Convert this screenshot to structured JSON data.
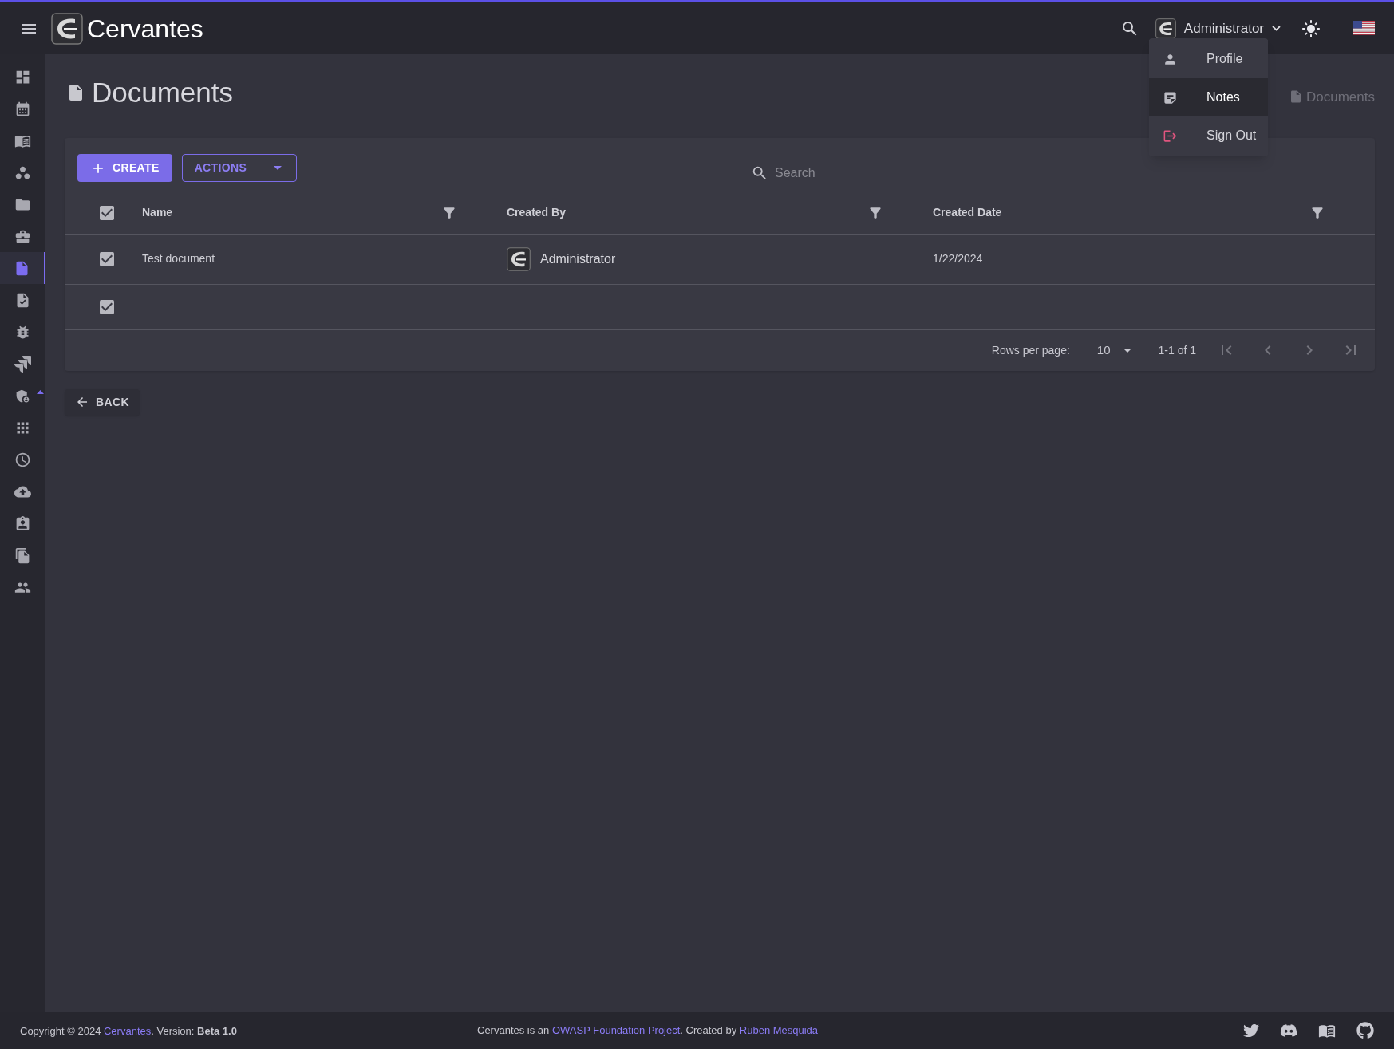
{
  "header": {
    "app_name": "Cervantes",
    "user_name": "Administrator"
  },
  "user_menu": [
    {
      "kind": "profile",
      "label": "Profile",
      "selected": false
    },
    {
      "kind": "notes",
      "label": "Notes",
      "selected": true
    },
    {
      "kind": "signout",
      "label": "Sign Out",
      "selected": false
    }
  ],
  "sidebar": {
    "items": [
      {
        "kind": "dashboard",
        "selected": false
      },
      {
        "kind": "calendar",
        "selected": false
      },
      {
        "kind": "book",
        "selected": false
      },
      {
        "kind": "circles",
        "selected": false
      },
      {
        "kind": "folder",
        "selected": false
      },
      {
        "kind": "briefcase",
        "selected": false
      },
      {
        "kind": "document",
        "selected": true
      },
      {
        "kind": "task",
        "selected": false
      },
      {
        "kind": "bug",
        "selected": false
      },
      {
        "kind": "jira",
        "selected": false
      },
      {
        "kind": "shield",
        "selected": false
      },
      {
        "kind": "grid",
        "selected": false
      },
      {
        "kind": "clock",
        "selected": false
      },
      {
        "kind": "upload",
        "selected": false
      },
      {
        "kind": "badge",
        "selected": false
      },
      {
        "kind": "copy",
        "selected": false
      },
      {
        "kind": "people",
        "selected": false
      }
    ]
  },
  "page": {
    "title": "Documents",
    "breadcrumb": "Documents"
  },
  "toolbar": {
    "create": "CREATE",
    "actions": "ACTIONS",
    "search_placeholder": "Search"
  },
  "table": {
    "select_all_checked": true,
    "columns": [
      "Name",
      "Created By",
      "Created Date"
    ],
    "rows": [
      {
        "checked": true,
        "name": "Test document",
        "created_by": "Administrator",
        "created_date": "1/22/2024"
      },
      {
        "checked": true
      }
    ]
  },
  "pagination": {
    "rows_per_page_label": "Rows per page:",
    "rows_per_page": "10",
    "range": "1-1 of 1",
    "buttons": [
      {
        "kind": "first",
        "disabled": true
      },
      {
        "kind": "prev",
        "disabled": true
      },
      {
        "kind": "next",
        "disabled": true
      },
      {
        "kind": "last",
        "disabled": true
      }
    ]
  },
  "back_button": "BACK",
  "footer": {
    "left": [
      {
        "kind": "text",
        "text": "Copyright © 2024 "
      },
      {
        "kind": "link",
        "text": "Cervantes"
      },
      {
        "kind": "text",
        "text": ". Version: "
      },
      {
        "kind": "bold",
        "text": "Beta 1.0"
      }
    ],
    "center": [
      {
        "kind": "text",
        "text": "Cervantes is an "
      },
      {
        "kind": "link",
        "text": "OWASP Foundation Project"
      },
      {
        "kind": "text",
        "text": ". Created by "
      },
      {
        "kind": "link",
        "text": "Ruben Mesquida"
      }
    ]
  }
}
